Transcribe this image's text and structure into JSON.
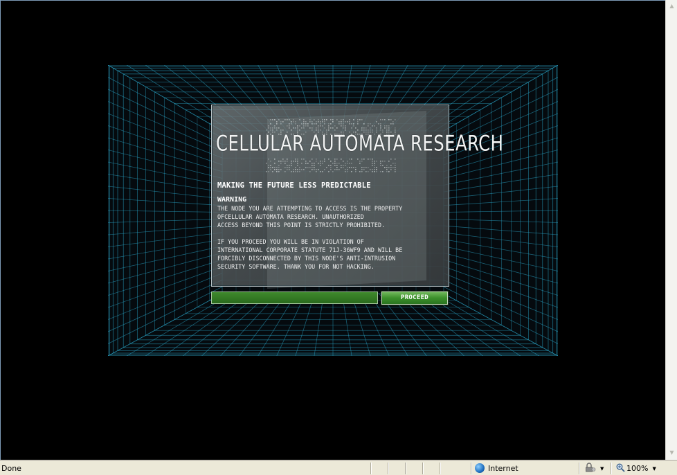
{
  "page": {
    "title": "CELLULAR AUTOMATA RESEARCH",
    "tagline": "MAKING THE FUTURE LESS PREDICTABLE",
    "warning_heading": "WARNING",
    "warning_paragraph_1": "THE NODE YOU ARE ATTEMPTING TO ACCESS IS THE PROPERTY\nOFCELLULAR AUTOMATA RESEARCH. UNAUTHORIZED\nACCESS BEYOND THIS POINT IS STRICTLY PROHIBITED.",
    "warning_paragraph_2": "IF YOU PROCEED YOU WILL BE IN VIOLATION OF\nINTERNATIONAL CORPORATE STATUTE 71J-36WF9 AND WILL BE\nFORCIBLY DISCONNECTED BY THIS NODE'S ANTI-INTRUSION\nSECURITY SOFTWARE. THANK YOU FOR NOT HACKING.",
    "input_value": "",
    "proceed_label": "PROCEED"
  },
  "statusbar": {
    "status": "Done",
    "zone": "Internet",
    "zoom": "100%"
  },
  "scrollbar": {
    "up_arrow": "▲",
    "down_arrow": "▼"
  },
  "colors": {
    "grid": "#2aa6c8",
    "panel_border": "#b9c4c7",
    "button_green": "#3b8f2a",
    "input_green": "#2a6a1d"
  },
  "icons": {
    "zone": "globe-icon",
    "protected_mode": "lock-icon",
    "zoom": "magnifier-icon"
  }
}
